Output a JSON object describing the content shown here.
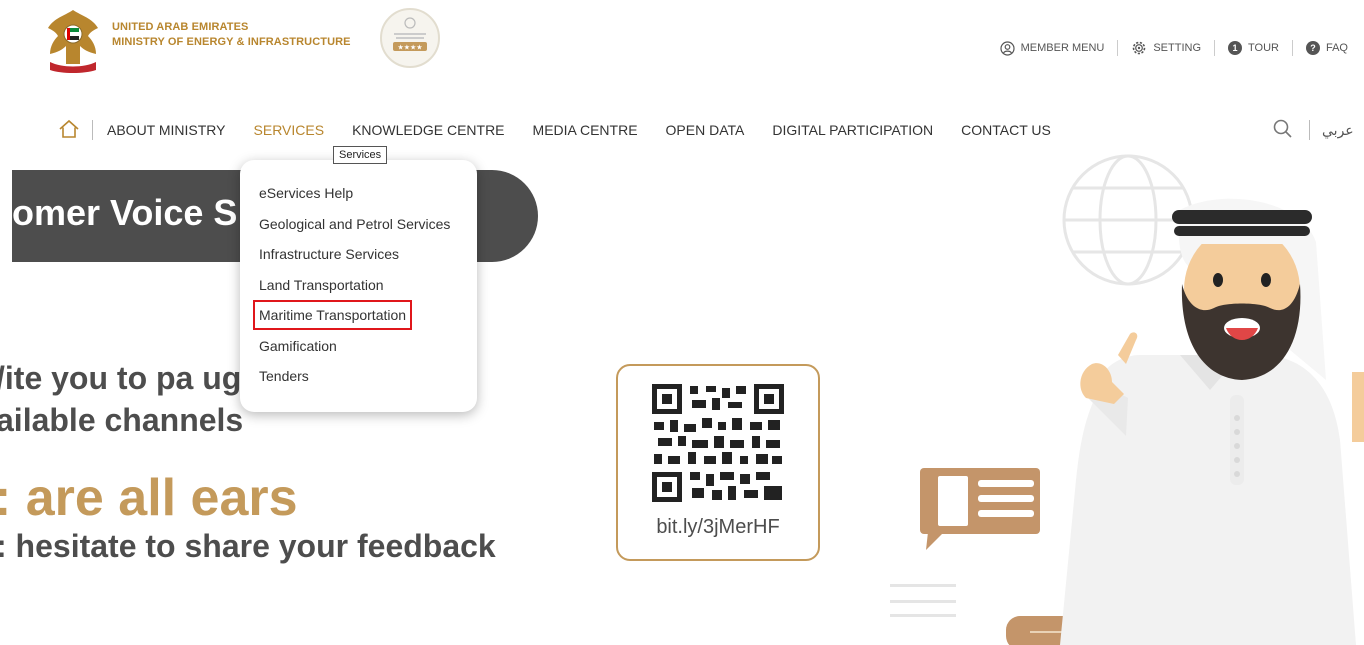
{
  "header": {
    "ministry_line1": "UNITED ARAB EMIRATES",
    "ministry_line2": "MINISTRY OF ENERGY & INFRASTRUCTURE",
    "top_links": [
      {
        "label": "MEMBER MENU",
        "icon": "user-circle-icon"
      },
      {
        "label": "SETTING",
        "icon": "gear-icon"
      },
      {
        "label": "TOUR",
        "icon": "number-one-icon"
      },
      {
        "label": "FAQ",
        "icon": "question-icon"
      }
    ],
    "tour_badge": "1",
    "faq_badge": "?"
  },
  "nav": {
    "items": [
      "ABOUT MINISTRY",
      "SERVICES",
      "KNOWLEDGE CENTRE",
      "MEDIA CENTRE",
      "OPEN DATA",
      "DIGITAL PARTICIPATION",
      "CONTACT US"
    ],
    "active": "SERVICES",
    "language": "عربي"
  },
  "tooltip": "Services",
  "dropdown": {
    "items": [
      "eServices Help",
      "Geological and Petrol Services",
      "Infrastructure Services",
      "Land Transportation",
      "Maritime Transportation",
      "Gamification",
      "Tenders"
    ],
    "highlighted": "Maritime Transportation"
  },
  "hero": {
    "voice_title": "omer Voice S",
    "invite_line1": "/ite you to pa          ugh all",
    "invite_line2": "ailable channels",
    "ears": ": are all ears",
    "hesitate": ": hesitate to share your feedback",
    "qr_url": "bit.ly/3jMerHF"
  },
  "colors": {
    "brand_gold": "#b8862e",
    "hero_gray": "#4d4d4d",
    "accent_tan": "#c49a5b",
    "highlight_red": "#e0161b"
  }
}
